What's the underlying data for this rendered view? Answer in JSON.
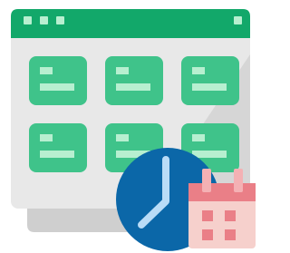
{
  "illustration": {
    "subject": "calendar-with-clock",
    "colors": {
      "window_body": "#e8e8e8",
      "window_body_shadow": "#d6d6d6",
      "window_base": "#cfcfcf",
      "titlebar": "#12a86a",
      "titlebar_dots": "#b7efd0",
      "card": "#3fc38a",
      "card_line": "#b7efd0",
      "clock_face": "#0b67a8",
      "clock_hands": "#b9dcf7",
      "calendar_body": "#f6d0cc",
      "calendar_header": "#ea7f87",
      "calendar_rings": "#f4b1b4",
      "calendar_cells": "#ea7f87"
    },
    "titlebar_dot_count": 3,
    "card_grid": {
      "rows": 2,
      "columns": 3
    },
    "calendar_cell_count": 4
  }
}
